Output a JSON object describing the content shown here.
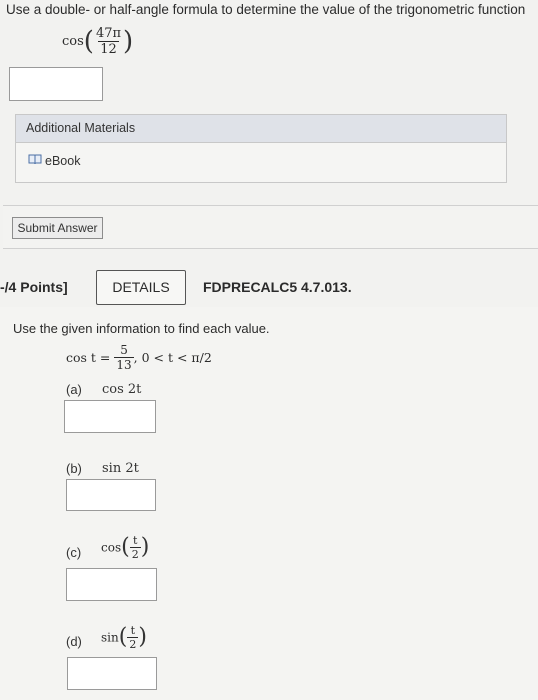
{
  "question1": {
    "prompt": "Use a double- or half-angle formula to determine the value of the trigonometric function",
    "func": "cos",
    "numerator": "47π",
    "denominator": "12"
  },
  "materials": {
    "title": "Additional Materials",
    "ebook_label": "eBook"
  },
  "submit_label": "Submit Answer",
  "question2": {
    "points_label": "-/4 Points]",
    "details_label": "DETAILS",
    "code": "FDPRECALC5 4.7.013.",
    "prompt": "Use the given information to find each value.",
    "given": {
      "lhs": "cos t =",
      "num": "5",
      "den": "13",
      "condition": ",   0 < t < π/2"
    },
    "parts": [
      {
        "label": "(a)",
        "expr": "cos 2t"
      },
      {
        "label": "(b)",
        "expr": "sin 2t"
      },
      {
        "label": "(c)",
        "func": "cos",
        "num": "t",
        "den": "2"
      },
      {
        "label": "(d)",
        "func": "sin",
        "num": "t",
        "den": "2"
      }
    ]
  },
  "colors": {
    "page_bg": "#f2f2f0",
    "materials_header_bg": "#dfe2e8",
    "panel_border": "#c8c8c8"
  },
  "icons": {
    "ebook": "book-icon"
  }
}
